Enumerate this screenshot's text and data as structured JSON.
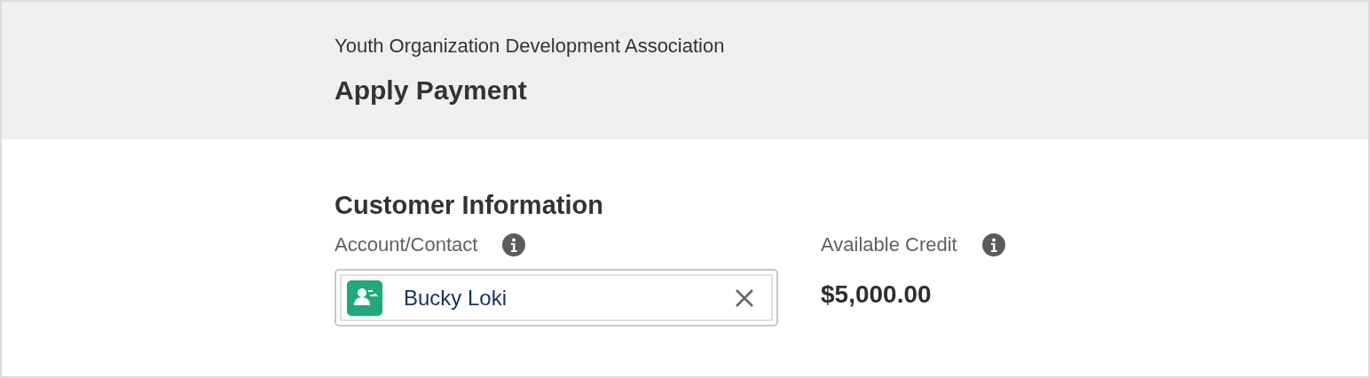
{
  "header": {
    "organization": "Youth Organization Development Association",
    "title": "Apply Payment"
  },
  "section": {
    "title": "Customer Information"
  },
  "account_field": {
    "label": "Account/Contact",
    "value": "Bucky Loki"
  },
  "available_credit": {
    "label": "Available Credit",
    "value": "$5,000.00"
  }
}
